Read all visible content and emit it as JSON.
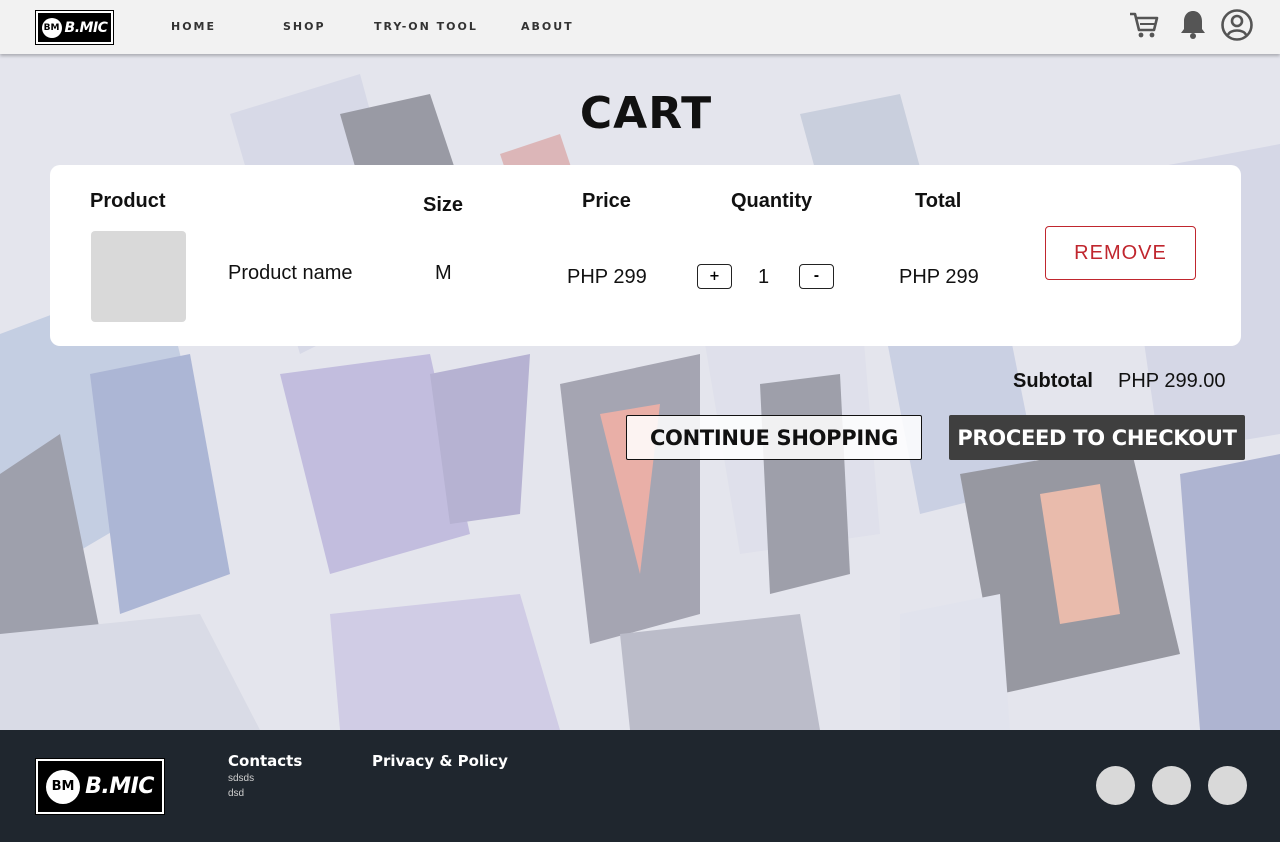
{
  "header": {
    "logo_text": "B.MIC",
    "logo_badge": "BM",
    "nav": [
      {
        "label": "HOME"
      },
      {
        "label": "SHOP"
      },
      {
        "label": "TRY-ON TOOL"
      },
      {
        "label": "ABOUT"
      }
    ],
    "icons": [
      "cart-icon",
      "bell-icon",
      "account-icon"
    ]
  },
  "page": {
    "title": "CART"
  },
  "cart": {
    "columns": {
      "product": "Product",
      "size": "Size",
      "price": "Price",
      "quantity": "Quantity",
      "total": "Total"
    },
    "items": [
      {
        "name": "Product name",
        "size": "M",
        "price": "PHP 299",
        "quantity": "1",
        "total": "PHP 299",
        "increment_label": "+",
        "decrement_label": "-",
        "remove_label": "REMOVE"
      }
    ]
  },
  "summary": {
    "subtotal_label": "Subtotal",
    "subtotal_value": "PHP 299.00",
    "continue_label": "CONTINUE SHOPPING",
    "checkout_label": "PROCEED TO CHECKOUT"
  },
  "footer": {
    "logo_text": "B.MIC",
    "logo_badge": "BM",
    "contacts_heading": "Contacts",
    "contacts_lines": [
      "sdsds",
      "dsd"
    ],
    "privacy_heading": "Privacy & Policy",
    "socials": [
      "social-icon",
      "social-icon",
      "social-icon"
    ]
  },
  "colors": {
    "remove": "#c0262e",
    "checkout_bg": "#3f3f3f",
    "footer_bg": "#1f262e"
  }
}
